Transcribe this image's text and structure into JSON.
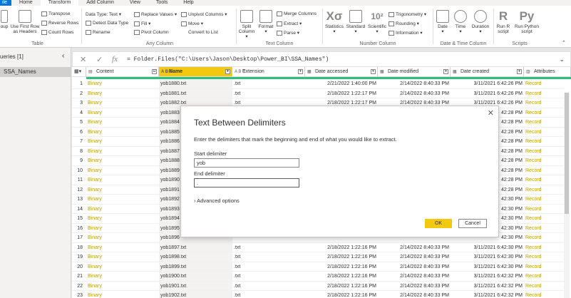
{
  "tabs": [
    "ile",
    "Home",
    "Transform",
    "Add Column",
    "View",
    "Tools",
    "Help"
  ],
  "ribbon": {
    "table_group": {
      "name": "Table",
      "group_by": "oup",
      "use_first_row": "Use First Row",
      "as_headers": "as Headers",
      "transpose": "Transpose",
      "reverse_rows": "Reverse Rows",
      "count_rows": "Count Rows"
    },
    "any_column_group": {
      "name": "Any Column",
      "data_type": "Data Type: Text",
      "detect_data_type": "Detect Data Type",
      "rename": "Rename",
      "replace_values": "Replace Values",
      "fill": "Fill",
      "pivot_column": "Pivot Column",
      "unpivot_columns": "Unpivot Columns",
      "move": "Move",
      "convert_to_list": "Convert to List"
    },
    "text_column_group": {
      "name": "Text Column",
      "split_column": "Split",
      "split_column2": "Column",
      "format": "Format",
      "merge_columns": "Merge Columns",
      "extract": "Extract",
      "parse": "Parse"
    },
    "number_column_group": {
      "name": "Number Column",
      "statistics": "Statistics",
      "standard": "Standard",
      "scientific": "Scientific",
      "trigonometry": "Trigonometry",
      "rounding": "Rounding",
      "information": "Information"
    },
    "date_time_group": {
      "name": "Date & Time Column",
      "date": "Date",
      "time": "Time",
      "duration": "Duration"
    },
    "scripts_group": {
      "name": "Scripts",
      "run_r": "Run R",
      "run_r2": "script",
      "run_python": "Run Python",
      "run_python2": "script"
    }
  },
  "queries": {
    "header": "ueries [1]",
    "items": [
      "SSA_Names"
    ]
  },
  "formula": {
    "text": "= Folder.Files(\"C:\\Users\\Jason\\Desktop\\Power_BI\\SSA_Names\")"
  },
  "columns": [
    {
      "type": "▤",
      "label": "Content"
    },
    {
      "type": "A B C",
      "label": "Name"
    },
    {
      "type": "A B C",
      "label": "Extension"
    },
    {
      "type": "▦",
      "label": "Date accessed"
    },
    {
      "type": "▦",
      "label": "Date modified"
    },
    {
      "type": "▦",
      "label": "Date created"
    },
    {
      "type": "▥",
      "label": "Attributes"
    }
  ],
  "rows": [
    {
      "n": "1",
      "content": "Binary",
      "name": "yob1880.txt",
      "ext": ".txt",
      "acc": "2/21/2022 1:40:00 PM",
      "mod": "2/14/2022 8:40:33 PM",
      "cre": "3/11/2021 6:42:26 PM",
      "att": "Record"
    },
    {
      "n": "2",
      "content": "Binary",
      "name": "yob1881.txt",
      "ext": ".txt",
      "acc": "2/18/2022 1:22:17 PM",
      "mod": "2/14/2022 8:40:33 PM",
      "cre": "3/11/2021 6:42:26 PM",
      "att": "Record"
    },
    {
      "n": "3",
      "content": "Binary",
      "name": "yob1882.txt",
      "ext": ".txt",
      "acc": "2/18/2022 1:22:17 PM",
      "mod": "2/14/2022 8:40:33 PM",
      "cre": "3/11/2021 6:42:26 PM",
      "att": "Record"
    },
    {
      "n": "4",
      "content": "Binary",
      "name": "yob1883",
      "ext": "",
      "acc": "",
      "mod": "",
      "cre": "42:28 PM",
      "att": "Record"
    },
    {
      "n": "5",
      "content": "Binary",
      "name": "yob1884",
      "ext": "",
      "acc": "",
      "mod": "",
      "cre": "42:28 PM",
      "att": "Record"
    },
    {
      "n": "6",
      "content": "Binary",
      "name": "yob1885",
      "ext": "",
      "acc": "",
      "mod": "",
      "cre": "42:28 PM",
      "att": "Record"
    },
    {
      "n": "7",
      "content": "Binary",
      "name": "yob1886",
      "ext": "",
      "acc": "",
      "mod": "",
      "cre": "42:28 PM",
      "att": "Record"
    },
    {
      "n": "8",
      "content": "Binary",
      "name": "yob1887",
      "ext": "",
      "acc": "",
      "mod": "",
      "cre": "42:28 PM",
      "att": "Record"
    },
    {
      "n": "9",
      "content": "Binary",
      "name": "yob1888",
      "ext": "",
      "acc": "",
      "mod": "",
      "cre": "42:28 PM",
      "att": "Record"
    },
    {
      "n": "10",
      "content": "Binary",
      "name": "yob1889",
      "ext": "",
      "acc": "",
      "mod": "",
      "cre": "42:28 PM",
      "att": "Record"
    },
    {
      "n": "11",
      "content": "Binary",
      "name": "yob1890",
      "ext": "",
      "acc": "",
      "mod": "",
      "cre": "42:28 PM",
      "att": "Record"
    },
    {
      "n": "12",
      "content": "Binary",
      "name": "yob1891",
      "ext": "",
      "acc": "",
      "mod": "",
      "cre": "42:28 PM",
      "att": "Record"
    },
    {
      "n": "13",
      "content": "Binary",
      "name": "yob1892",
      "ext": "",
      "acc": "",
      "mod": "",
      "cre": "42:30 PM",
      "att": "Record"
    },
    {
      "n": "14",
      "content": "Binary",
      "name": "yob1893",
      "ext": "",
      "acc": "",
      "mod": "",
      "cre": "42:30 PM",
      "att": "Record"
    },
    {
      "n": "15",
      "content": "Binary",
      "name": "yob1894",
      "ext": "",
      "acc": "",
      "mod": "",
      "cre": "42:30 PM",
      "att": "Record"
    },
    {
      "n": "16",
      "content": "Binary",
      "name": "yob1895",
      "ext": "",
      "acc": "",
      "mod": "",
      "cre": "42:30 PM",
      "att": "Record"
    },
    {
      "n": "17",
      "content": "Binary",
      "name": "yob1896",
      "ext": "",
      "acc": "",
      "mod": "",
      "cre": "42:30 PM",
      "att": "Record"
    },
    {
      "n": "18",
      "content": "Binary",
      "name": "yob1897.txt",
      "ext": ".txt",
      "acc": "2/18/2022 1:22:16 PM",
      "mod": "2/14/2022 8:40:33 PM",
      "cre": "3/11/2021 6:42:30 PM",
      "att": "Record"
    },
    {
      "n": "19",
      "content": "Binary",
      "name": "yob1898.txt",
      "ext": ".txt",
      "acc": "2/18/2022 1:22:16 PM",
      "mod": "2/14/2022 8:40:33 PM",
      "cre": "3/11/2021 6:42:30 PM",
      "att": "Record"
    },
    {
      "n": "20",
      "content": "Binary",
      "name": "yob1899.txt",
      "ext": ".txt",
      "acc": "2/18/2022 1:22:16 PM",
      "mod": "2/14/2022 8:40:33 PM",
      "cre": "3/11/2021 6:42:30 PM",
      "att": "Record"
    },
    {
      "n": "21",
      "content": "Binary",
      "name": "yob1900.txt",
      "ext": ".txt",
      "acc": "2/18/2022 1:22:16 PM",
      "mod": "2/14/2022 8:40:33 PM",
      "cre": "3/11/2021 6:42:32 PM",
      "att": "Record"
    },
    {
      "n": "22",
      "content": "Binary",
      "name": "yob1901.txt",
      "ext": ".txt",
      "acc": "2/18/2022 1:22:16 PM",
      "mod": "2/14/2022 8:40:33 PM",
      "cre": "3/11/2021 6:42:32 PM",
      "att": "Record"
    },
    {
      "n": "23",
      "content": "Binary",
      "name": "yob1902.txt",
      "ext": ".txt",
      "acc": "2/18/2022 1:22:16 PM",
      "mod": "2/14/2022 8:40:33 PM",
      "cre": "3/11/2021 6:42:32 PM",
      "att": "Record"
    }
  ],
  "dialog": {
    "title": "Text Between Delimiters",
    "description": "Enter the delimiters that mark the beginning and end of what you would like to extract.",
    "start_label": "Start delimiter",
    "start_value": "yob",
    "end_label": "End delimiter",
    "end_value": ".",
    "advanced": "Advanced options",
    "ok": "OK",
    "cancel": "Cancel"
  },
  "colors": {
    "accent": "#f2c811",
    "file_tab": "#0078d4",
    "quality_bar": "#2ebd7a",
    "record_text": "#c19c00"
  }
}
